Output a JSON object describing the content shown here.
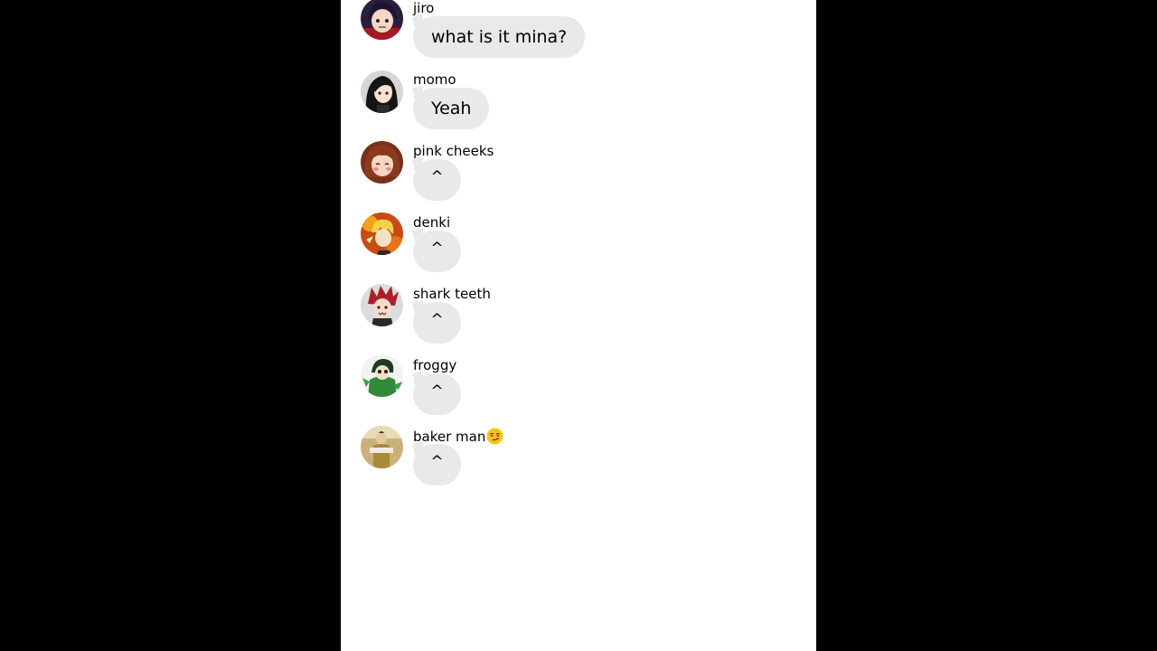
{
  "colors": {
    "background": "#000000",
    "screen": "#ffffff",
    "bubble": "#e9e9eb",
    "text": "#000000"
  },
  "messages": [
    {
      "sender": "jiro",
      "text": "what is it mina?",
      "avatar_icon": "purple-hair-girl-avatar"
    },
    {
      "sender": "momo",
      "text": "Yeah",
      "avatar_icon": "black-hair-girl-avatar"
    },
    {
      "sender": "pink cheeks",
      "text": "^",
      "avatar_icon": "brown-hair-girl-avatar"
    },
    {
      "sender": "denki",
      "text": "^",
      "avatar_icon": "yellow-hair-boy-avatar"
    },
    {
      "sender": "shark teeth",
      "text": "^",
      "avatar_icon": "red-hair-boy-avatar"
    },
    {
      "sender": "froggy",
      "text": "^",
      "avatar_icon": "green-frog-girl-avatar"
    },
    {
      "sender": "baker man",
      "text": "^",
      "avatar_icon": "gold-costume-avatar",
      "sender_emoji": "smirking-face-emoji"
    }
  ]
}
